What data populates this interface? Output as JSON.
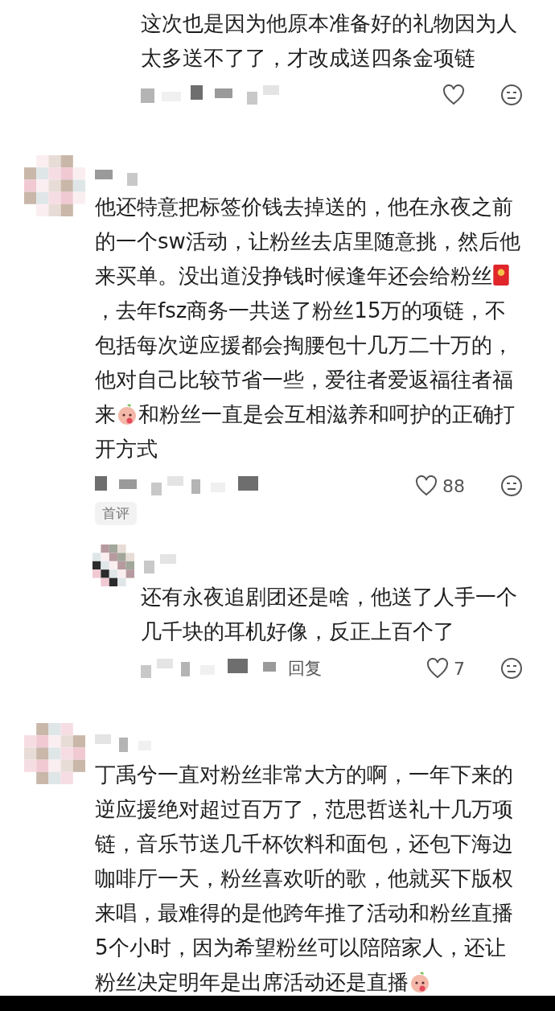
{
  "comments": [
    {
      "kind": "reply_tail",
      "body": [
        {
          "kind": "text",
          "text": "这次也是因为他原本准备好的礼物因为人太多送不了了，才改成送四条金项链"
        }
      ]
    },
    {
      "kind": "comment",
      "body": [
        {
          "kind": "text",
          "text": "他还特意把标签价钱去掉送的，他在永夜之前的一个sw活动，让粉丝去店里随意挑，然后他来买单。没出道没挣钱时候逢年还会给粉丝"
        },
        {
          "kind": "envelope"
        },
        {
          "kind": "text",
          "text": "，去年fsz商务一共送了粉丝15万的项链，不包括每次逆应援都会掏腰包十几万二十万的，他对自己比较节省一些，爱往者爱返福往者福来"
        },
        {
          "kind": "emoji"
        },
        {
          "kind": "text",
          "text": "和粉丝一直是会互相滋养和呵护的正确打开方式"
        }
      ],
      "likes": "88",
      "badge": "首评"
    },
    {
      "kind": "reply",
      "body": [
        {
          "kind": "text",
          "text": "还有永夜追剧团还是啥，他送了人手一个几千块的耳机好像，反正上百个了"
        }
      ],
      "reply_link": "回复",
      "likes": "7"
    },
    {
      "kind": "comment_cut",
      "body": [
        {
          "kind": "text",
          "text": "丁禹兮一直对粉丝非常大方的啊，一年下来的逆应援绝对超过百万了，范思哲送礼十几万项链，音乐节送几千杯饮料和面包，还包下海边咖啡厅一天，粉丝喜欢听的歌，他就买下版权来唱，最难得的是他跨年推了活动和粉丝直播5个小时，因为希望粉丝可以陪陪家人，还让粉丝决定明年是出席活动还是直播"
        },
        {
          "kind": "emoji"
        }
      ]
    }
  ]
}
